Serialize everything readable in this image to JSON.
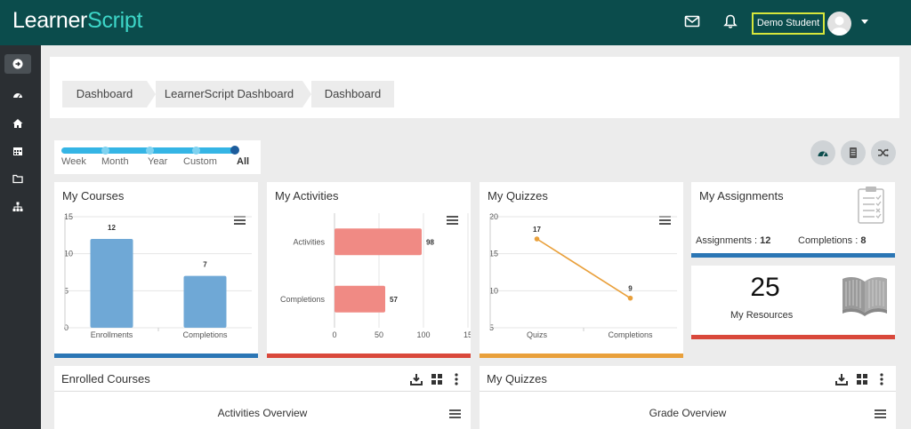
{
  "app": {
    "logo_part1": "Learner",
    "logo_part2": "Script",
    "user_name": "Demo Student",
    "colors": {
      "topbar": "#0b4c4c",
      "sidebar": "#2b2f33",
      "accent_teal": "#3dd6c8",
      "user_box_border": "#d6e63b"
    }
  },
  "sidebar": {
    "items": [
      {
        "icon": "arrow-right-circle-icon"
      },
      {
        "icon": "dashboard-gauge-icon"
      },
      {
        "icon": "home-icon"
      },
      {
        "icon": "calendar-icon"
      },
      {
        "icon": "folder-icon"
      },
      {
        "icon": "sitemap-icon"
      }
    ]
  },
  "breadcrumb": {
    "items": [
      "Dashboard",
      "LearnerScript Dashboard",
      "Dashboard"
    ]
  },
  "filter": {
    "options": [
      "Week",
      "Month",
      "Year",
      "Custom",
      "All"
    ],
    "selected": "All"
  },
  "toolbar": {
    "icons": [
      "dashboard-icon",
      "report-icon",
      "shuffle-icon"
    ]
  },
  "cards": {
    "courses": {
      "title": "My Courses",
      "bar_color": "#2b76b5"
    },
    "activities": {
      "title": "My Activities",
      "bar_color": "#d9483b"
    },
    "quizzes": {
      "title": "My Quizzes",
      "bar_color": "#e9a03b"
    },
    "assignments": {
      "title": "My Assignments",
      "assignments_label": "Assignments : ",
      "assignments_value": "12",
      "completions_label": "Completions : ",
      "completions_value": "8",
      "bar_color": "#2b76b5"
    },
    "resources": {
      "count": "25",
      "label": "My Resources",
      "bar_color": "#d9483b"
    }
  },
  "panels": {
    "enrolled": {
      "title": "Enrolled Courses",
      "subtitle": "Activities Overview"
    },
    "quizzes": {
      "title": "My Quizzes",
      "subtitle": "Grade Overview"
    }
  },
  "chart_data": [
    {
      "type": "bar",
      "title": "My Courses",
      "categories": [
        "Enrollments",
        "Completions"
      ],
      "values": [
        12,
        7
      ],
      "ylim": [
        0,
        15
      ],
      "yticks": [
        0,
        5,
        10,
        15
      ],
      "color": "#6fa8d6"
    },
    {
      "type": "bar",
      "orientation": "horizontal",
      "title": "My Activities",
      "categories": [
        "Activities",
        "Completions"
      ],
      "values": [
        98,
        57
      ],
      "xlim": [
        0,
        150
      ],
      "xticks": [
        "0",
        "50",
        "100",
        "15"
      ],
      "color": "#f08a84"
    },
    {
      "type": "line",
      "title": "My Quizzes",
      "categories": [
        "Quizs",
        "Completions"
      ],
      "values": [
        17,
        9
      ],
      "ylim": [
        5,
        20
      ],
      "yticks": [
        5,
        10,
        15,
        20
      ],
      "color": "#e9a03b"
    }
  ]
}
